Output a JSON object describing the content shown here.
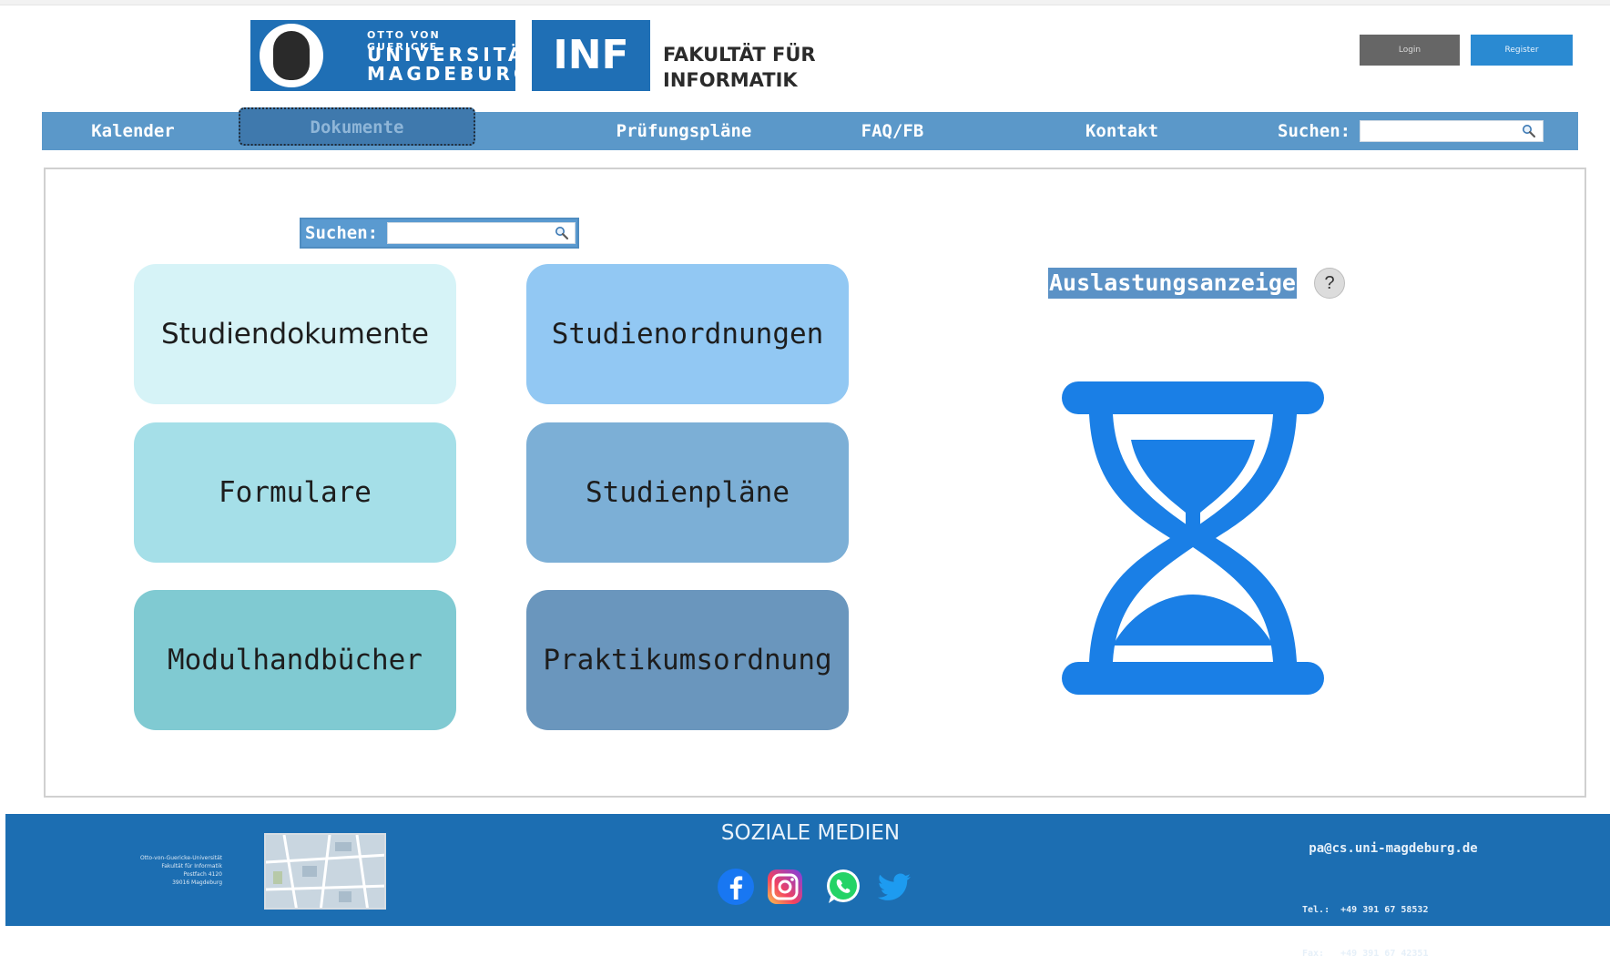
{
  "header": {
    "ovgu_logo": {
      "line_small": "OTTO VON GUERICKE",
      "line1": "UNIVERSITÄT",
      "line2": "MAGDEBURG"
    },
    "inf_logo": "INF",
    "faculty_line1": "FAKULTÄT FÜR",
    "faculty_line2": "INFORMATIK",
    "login_label": "Login",
    "register_label": "Register"
  },
  "nav": {
    "items": [
      {
        "label": "Kalender",
        "active": false
      },
      {
        "label": "Dokumente",
        "active": true
      },
      {
        "label": "Prüfungspläne",
        "active": false
      },
      {
        "label": "FAQ/FB",
        "active": false
      },
      {
        "label": "Kontakt",
        "active": false
      }
    ],
    "search_label": "Suchen:",
    "search_value": ""
  },
  "documents": {
    "search_label": "Suchen:",
    "search_value": "",
    "tiles": [
      {
        "label": "Studiendokumente",
        "color": "#d6f3f7"
      },
      {
        "label": "Studienordnungen",
        "color": "#92c8f3"
      },
      {
        "label": "Formulare",
        "color": "#a5dfe8"
      },
      {
        "label": "Studienpläne",
        "color": "#7cafd6"
      },
      {
        "label": "Modulhandbücher",
        "color": "#80cad2"
      },
      {
        "label": "Praktikumsordnung",
        "color": "#6a96bd"
      }
    ]
  },
  "load_display": {
    "title": "Auslastungsanzeige",
    "help_label": "?",
    "icon": "hourglass-icon",
    "icon_color": "#1a7fe6"
  },
  "footer": {
    "address_lines": [
      "Otto-von-Guericke-Universität",
      "Fakultät für Informatik",
      "Postfach 4120",
      "39016 Magdeburg"
    ],
    "social_title": "SOZIALE MEDIEN",
    "social_icons": [
      "facebook-icon",
      "instagram-icon",
      "whatsapp-icon",
      "twitter-icon"
    ],
    "email": "pa@cs.uni-magdeburg.de",
    "phone": "Tel.:  +49 391 67 58532",
    "fax": "Fax:   +49 391 67 42351"
  },
  "colors": {
    "brand_blue": "#1f6fb5",
    "nav_blue": "#5b98c9",
    "footer_blue": "#1c6eb2"
  }
}
